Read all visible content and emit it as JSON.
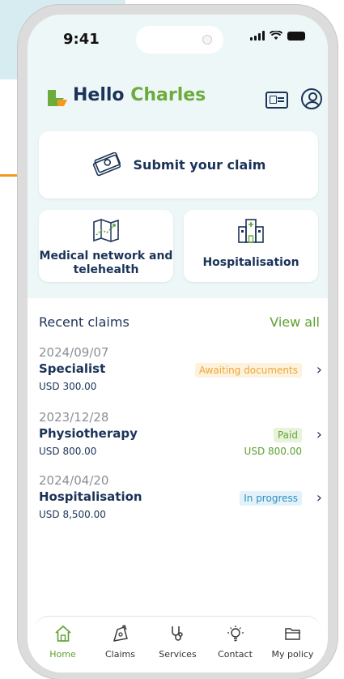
{
  "status_bar": {
    "time": "9:41"
  },
  "header": {
    "hello": "Hello",
    "name": "Charles"
  },
  "actions": {
    "submit_claim": "Submit your claim",
    "medical_network": "Medical network and telehealth",
    "hospitalisation": "Hospitalisation"
  },
  "recent": {
    "title": "Recent claims",
    "view_all": "View all",
    "claims": [
      {
        "date": "2024/09/07",
        "type": "Specialist",
        "amount": "USD 300.00",
        "status": "Awaiting documents",
        "paid_amount": ""
      },
      {
        "date": "2023/12/28",
        "type": "Physiotherapy",
        "amount": "USD 800.00",
        "status": "Paid",
        "paid_amount": "USD 800.00"
      },
      {
        "date": "2024/04/20",
        "type": "Hospitalisation",
        "amount": "USD 8,500.00",
        "status": "In progress",
        "paid_amount": ""
      }
    ]
  },
  "nav": {
    "items": [
      {
        "label": "Home",
        "icon": "home-icon",
        "active": true
      },
      {
        "label": "Claims",
        "icon": "claims-icon",
        "active": false
      },
      {
        "label": "Services",
        "icon": "stethoscope-icon",
        "active": false
      },
      {
        "label": "Contact",
        "icon": "lightbulb-icon",
        "active": false
      },
      {
        "label": "My policy",
        "icon": "folder-icon",
        "active": false
      }
    ]
  },
  "colors": {
    "brand_navy": "#1b3358",
    "brand_green": "#6cab3c",
    "accent_orange": "#f29a1d",
    "status_awaiting": "#eea53c",
    "status_paid": "#6aa73a",
    "status_progress": "#2f8ec5"
  }
}
